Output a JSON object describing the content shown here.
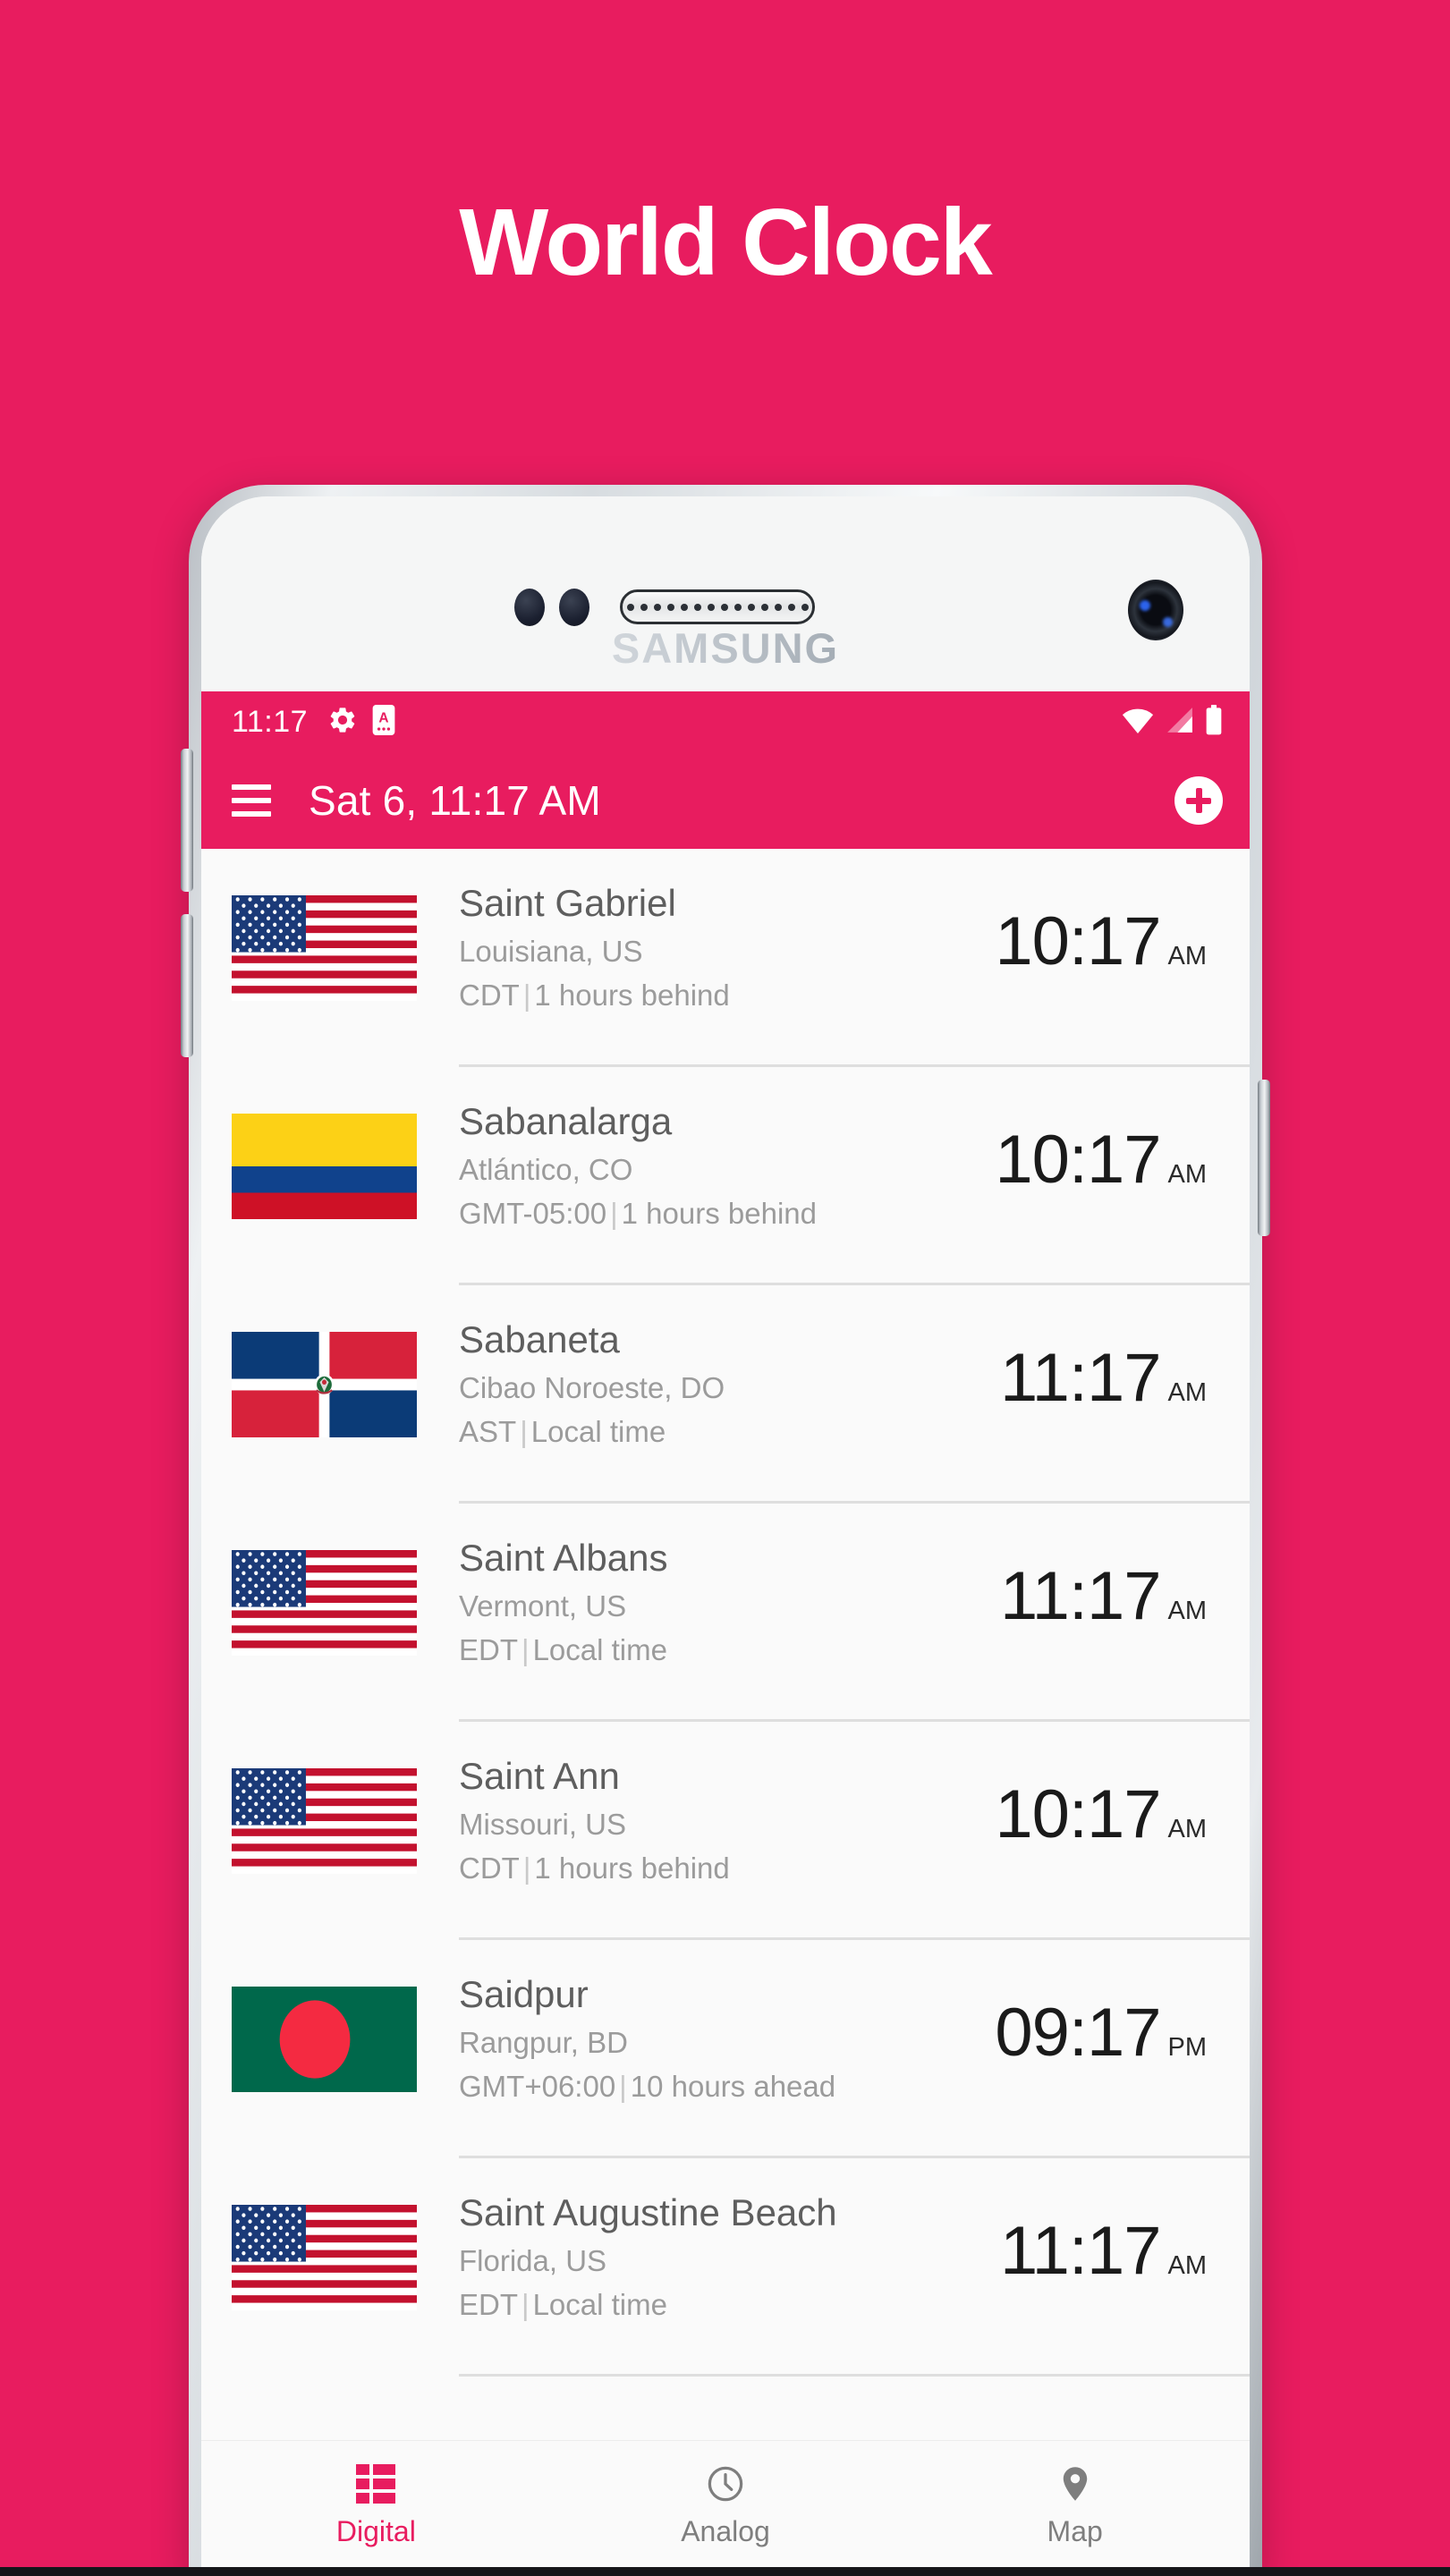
{
  "hero": {
    "title": "World Clock"
  },
  "device": {
    "brand": "SAMSUNG"
  },
  "statusbar": {
    "time": "11:17",
    "icons": [
      "gear-icon",
      "a-badge-icon",
      "wifi-icon",
      "signal-icon",
      "battery-icon"
    ]
  },
  "appbar": {
    "menu_icon": "hamburger-menu-icon",
    "title": "Sat 6, 11:17 AM",
    "add_icon": "plus-circle-icon"
  },
  "colors": {
    "accent": "#E81C5F",
    "screen_bg": "#FAFAFA",
    "primary_text": "#5E5E5E",
    "secondary_text": "#9B9B9B",
    "time_text": "#1A1A1A",
    "divider": "#DEDEDE"
  },
  "clocks": [
    {
      "flag": "us-flag",
      "city": "Saint Gabriel",
      "region": "Louisiana, US",
      "tz_abbr": "CDT",
      "offset_note": "1 hours behind",
      "time": "10:17",
      "ampm": "AM"
    },
    {
      "flag": "colombia-flag",
      "city": "Sabanalarga",
      "region": "Atlántico, CO",
      "tz_abbr": "GMT-05:00",
      "offset_note": "1 hours behind",
      "time": "10:17",
      "ampm": "AM"
    },
    {
      "flag": "dominican-republic-flag",
      "city": "Sabaneta",
      "region": "Cibao Noroeste, DO",
      "tz_abbr": "AST",
      "offset_note": "Local time",
      "time": "11:17",
      "ampm": "AM"
    },
    {
      "flag": "us-flag",
      "city": "Saint Albans",
      "region": "Vermont, US",
      "tz_abbr": "EDT",
      "offset_note": "Local time",
      "time": "11:17",
      "ampm": "AM"
    },
    {
      "flag": "us-flag",
      "city": "Saint Ann",
      "region": "Missouri, US",
      "tz_abbr": "CDT",
      "offset_note": "1 hours behind",
      "time": "10:17",
      "ampm": "AM"
    },
    {
      "flag": "bangladesh-flag",
      "city": "Saidpur",
      "region": "Rangpur, BD",
      "tz_abbr": "GMT+06:00",
      "offset_note": "10 hours ahead",
      "time": "09:17",
      "ampm": "PM"
    },
    {
      "flag": "us-flag",
      "city": "Saint Augustine Beach",
      "region": "Florida, US",
      "tz_abbr": "EDT",
      "offset_note": "Local time",
      "time": "11:17",
      "ampm": "AM"
    }
  ],
  "bottomnav": {
    "items": [
      {
        "label": "Digital",
        "icon": "list-grid-icon",
        "active": true
      },
      {
        "label": "Analog",
        "icon": "clock-icon",
        "active": false
      },
      {
        "label": "Map",
        "icon": "map-pin-icon",
        "active": false
      }
    ]
  }
}
